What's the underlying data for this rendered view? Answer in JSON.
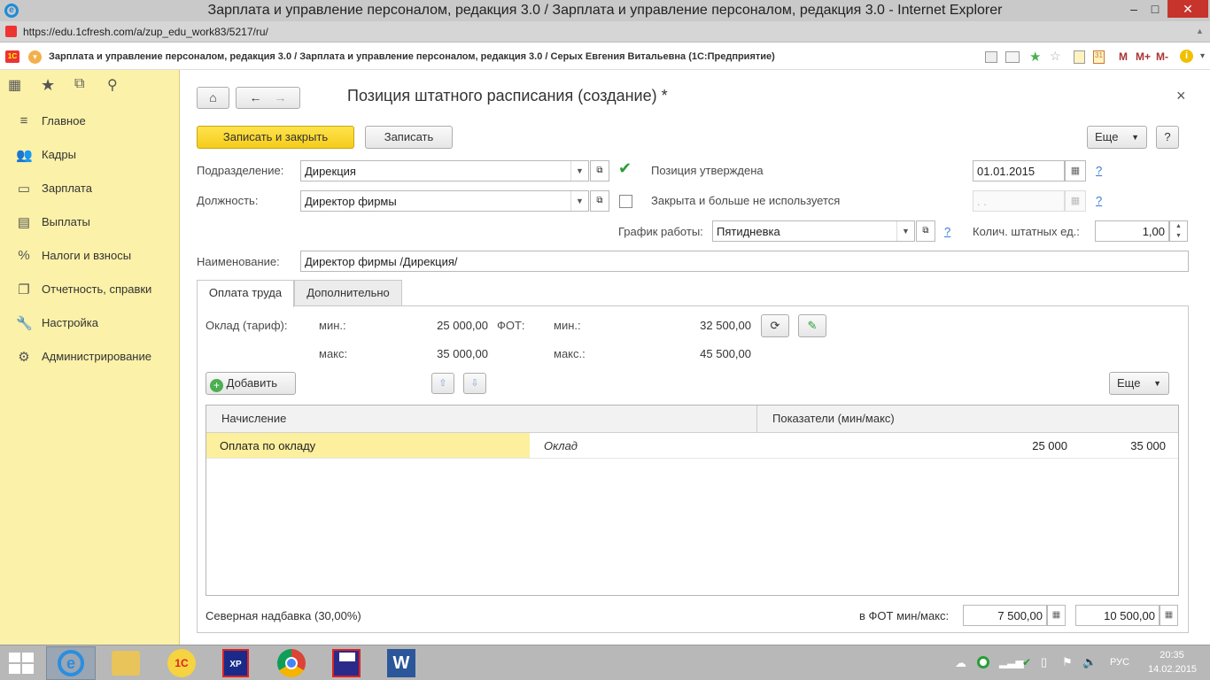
{
  "window": {
    "title": "Зарплата и управление персоналом, редакция 3.0 / Зарплата и управление персоналом, редакция 3.0 - Internet Explorer",
    "url": "https://edu.1cfresh.com/a/zup_edu_work83/5217/ru/",
    "app_title": "Зарплата и управление персоналом, редакция 3.0 / Зарплата и управление персоналом, редакция 3.0 / Серых Евгения Витальевна  (1С:Предприятие)",
    "controls": {
      "minimize": "–",
      "maximize": "□",
      "close": "✕"
    },
    "toolbar_labels": {
      "m": "M",
      "mplus": "M+",
      "mminus": "M-"
    }
  },
  "sidebar": {
    "items": [
      {
        "label": "Главное",
        "icon": "menu-icon"
      },
      {
        "label": "Кадры",
        "icon": "people-icon"
      },
      {
        "label": "Зарплата",
        "icon": "wallet-icon"
      },
      {
        "label": "Выплаты",
        "icon": "payment-icon"
      },
      {
        "label": "Налоги и взносы",
        "icon": "percent-icon"
      },
      {
        "label": "Отчетность, справки",
        "icon": "report-icon"
      },
      {
        "label": "Настройка",
        "icon": "wrench-icon"
      },
      {
        "label": "Администрирование",
        "icon": "gear-icon"
      }
    ]
  },
  "form": {
    "title": "Позиция штатного расписания (создание) *",
    "save_close": "Записать и закрыть",
    "save": "Записать",
    "more": "Еще",
    "help": "?",
    "close": "×",
    "department_label": "Подразделение:",
    "department_value": "Дирекция",
    "position_label": "Должность:",
    "position_value": "Директор фирмы",
    "approved_label": "Позиция утверждена",
    "approved_date": "01.01.2015",
    "closed_label": "Закрыта и больше не используется",
    "closed_date": " .  .",
    "schedule_label": "График работы:",
    "schedule_value": "Пятидневка",
    "units_label": "Колич. штатных ед.:",
    "units_value": "1,00",
    "name_label": "Наименование:",
    "name_value": "Директор фирмы /Дирекция/",
    "q": "?"
  },
  "tabs": [
    {
      "label": "Оплата труда",
      "active": true
    },
    {
      "label": "Дополнительно",
      "active": false
    }
  ],
  "pay": {
    "salary_label": "Оклад (тариф):",
    "min_label": "мин.:",
    "max_label": "макс:",
    "salary_min": "25 000,00",
    "salary_max": "35 000,00",
    "fot_label": "ФОТ:",
    "fot_min_label": "мин.:",
    "fot_max_label": "макс.:",
    "fot_min": "32 500,00",
    "fot_max": "45 500,00",
    "add": "Добавить",
    "more": "Еще"
  },
  "grid": {
    "columns": [
      "Начисление",
      "Показатели (мин/макс)"
    ],
    "rows": [
      {
        "accrual": "Оплата по окладу",
        "indicator": "Оклад",
        "min": "25 000",
        "max": "35 000"
      }
    ]
  },
  "footer": {
    "north_label": "Северная надбавка (30,00%)",
    "fot_minmax_label": "в ФОТ мин/макс:",
    "fot_min": "7 500,00",
    "fot_max": "10 500,00"
  },
  "taskbar": {
    "lang": "РУС",
    "time": "20:35",
    "date": "14.02.2015",
    "apps": [
      "start-icon",
      "ie-icon",
      "explorer-icon",
      "1c-icon",
      "xp-icon",
      "chrome-icon",
      "floppy-icon",
      "word-icon"
    ]
  },
  "colors": {
    "accent_yellow": "#f5cc1a",
    "sidebar_bg": "#fbf1a8",
    "link_blue": "#3a7bd5",
    "check_green": "#2a9d3a"
  }
}
